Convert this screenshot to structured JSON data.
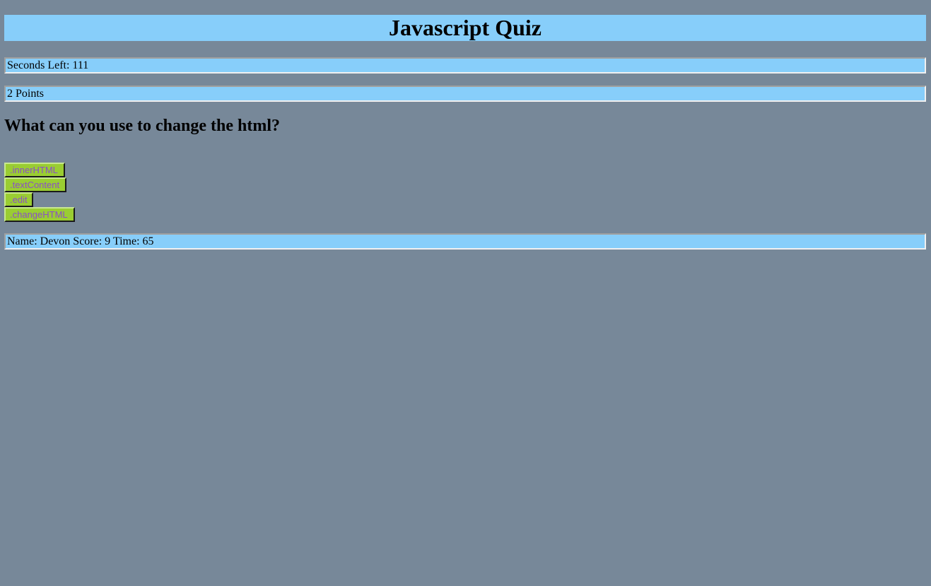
{
  "header": {
    "title": "Javascript Quiz"
  },
  "status": {
    "timer_text": "Seconds Left: 111",
    "points_text": "2 Points"
  },
  "quiz": {
    "question": "What can you use to change the html?",
    "answers": [
      {
        "label": ".innerHTML"
      },
      {
        "label": ".textContent"
      },
      {
        "label": ".edit"
      },
      {
        "label": ".changeHTML"
      }
    ]
  },
  "highscores": {
    "entry_text": "Name: Devon Score: 9 Time: 65"
  },
  "colors": {
    "page_background": "#778899",
    "panel_background": "#87cefa",
    "button_background": "#9acd32",
    "button_text": "#8a4fc8"
  }
}
